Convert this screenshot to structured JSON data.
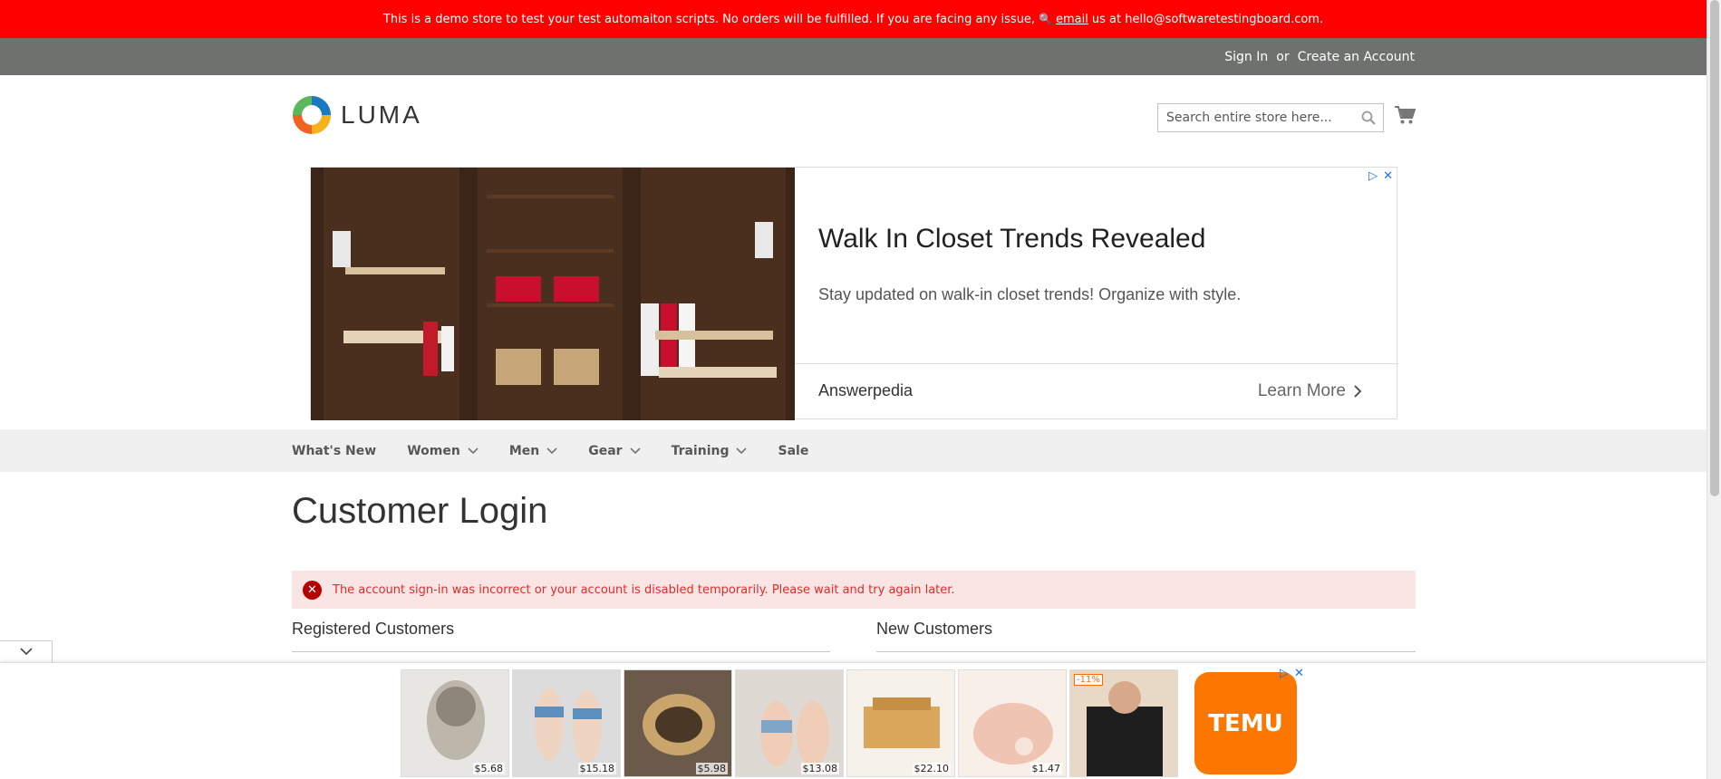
{
  "demo_notice": {
    "text": "This is a demo store to test your test automaiton scripts. No orders will be fulfilled. If you are facing any issue,",
    "email_link": "email",
    "suffix": "us at hello@softwaretestingboard.com."
  },
  "top_links": {
    "sign_in": "Sign In",
    "or": "or",
    "create_account": "Create an Account"
  },
  "logo": {
    "text": "LUMA"
  },
  "search": {
    "placeholder": "Search entire store here..."
  },
  "ad": {
    "title": "Walk In Closet Trends Revealed",
    "description": "Stay updated on walk-in closet trends! Organize with style.",
    "source": "Answerpedia",
    "cta": "Learn More"
  },
  "nav": {
    "items": [
      {
        "label": "What's New",
        "dropdown": false
      },
      {
        "label": "Women",
        "dropdown": true
      },
      {
        "label": "Men",
        "dropdown": true
      },
      {
        "label": "Gear",
        "dropdown": true
      },
      {
        "label": "Training",
        "dropdown": true
      },
      {
        "label": "Sale",
        "dropdown": false
      }
    ]
  },
  "page": {
    "title": "Customer Login"
  },
  "error": {
    "message": "The account sign-in was incorrect or your account is disabled temporarily. Please wait and try again later."
  },
  "sections": {
    "registered": "Registered Customers",
    "new": "New Customers"
  },
  "bottom_ad": {
    "products": [
      {
        "price": "$5.68",
        "color": "#cfc8bb"
      },
      {
        "price": "$15.18",
        "color": "#8aa7c4"
      },
      {
        "price": "$5.98",
        "color": "#7a5a3a"
      },
      {
        "price": "$13.08",
        "color": "#b8a58a"
      },
      {
        "price": "$22.10",
        "color": "#d8b47a"
      },
      {
        "price": "$1.47",
        "color": "#f1d0c4"
      },
      {
        "price": "",
        "color": "#2a2a2a",
        "badge": "-11%"
      }
    ],
    "brand": "TEMU"
  },
  "colors": {
    "demo_bar": "#ff0000",
    "top_links_bg": "#6e716e",
    "nav_bg": "#f0f0f0",
    "error_bg": "#fae5e5",
    "error_text": "#e02b27",
    "temu": "#fb7701"
  }
}
